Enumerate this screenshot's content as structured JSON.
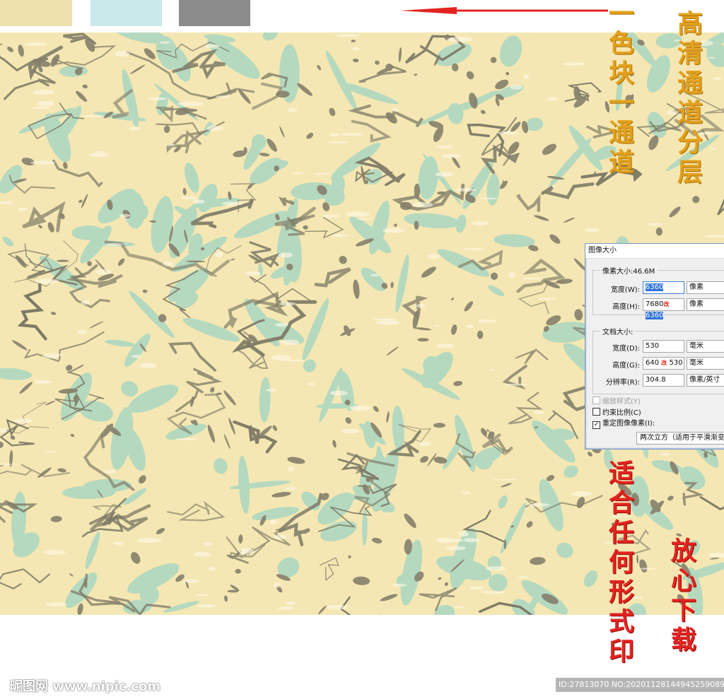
{
  "swatches": [
    {
      "name": "yellow",
      "color": "#efe1ae"
    },
    {
      "name": "cyan",
      "color": "#c9e9ea"
    },
    {
      "name": "gray",
      "color": "#8c8c8c"
    }
  ],
  "labels": {
    "left_vertical": "一色块一通道",
    "right_vertical": "高清通道分层",
    "bottom_left_vertical": "适合任何形式印",
    "bottom_right_vertical": "放心下载"
  },
  "dialog": {
    "title": "图像大小",
    "pixel_size": "像素大小:46.6M",
    "width_label": "宽度(W):",
    "width_value": "6360",
    "width_unit": "像素",
    "height_label": "高度(H):",
    "height_old": "7680",
    "height_value": "6360",
    "height_unit": "像素",
    "doc_size": "文档大小:",
    "doc_width_label": "宽度(D):",
    "doc_width_value": "530",
    "doc_width_unit": "毫米",
    "doc_height_label": "高度(G):",
    "doc_height_old": "640",
    "doc_height_value": "530",
    "doc_height_unit": "毫米",
    "change_mark": "改",
    "resolution_label": "分辨率(R):",
    "resolution_value": "304.8",
    "resolution_unit": "像素/英寸",
    "scale_styles": "缩放样式(Y)",
    "constrain": "约束比例(C)",
    "resample": "重定图像像素(I):",
    "method": "两次立方（适用于平滑渐变"
  },
  "watermarks": {
    "site": "昵图网 www.nipic.com",
    "id": "ID:27813070 NO:20201128144945259089"
  },
  "colors": {
    "base": "#f5e7b3",
    "vein_dark": "#7d7a66",
    "vein_green": "#a9d6c2",
    "arrow": "#e4231f"
  }
}
